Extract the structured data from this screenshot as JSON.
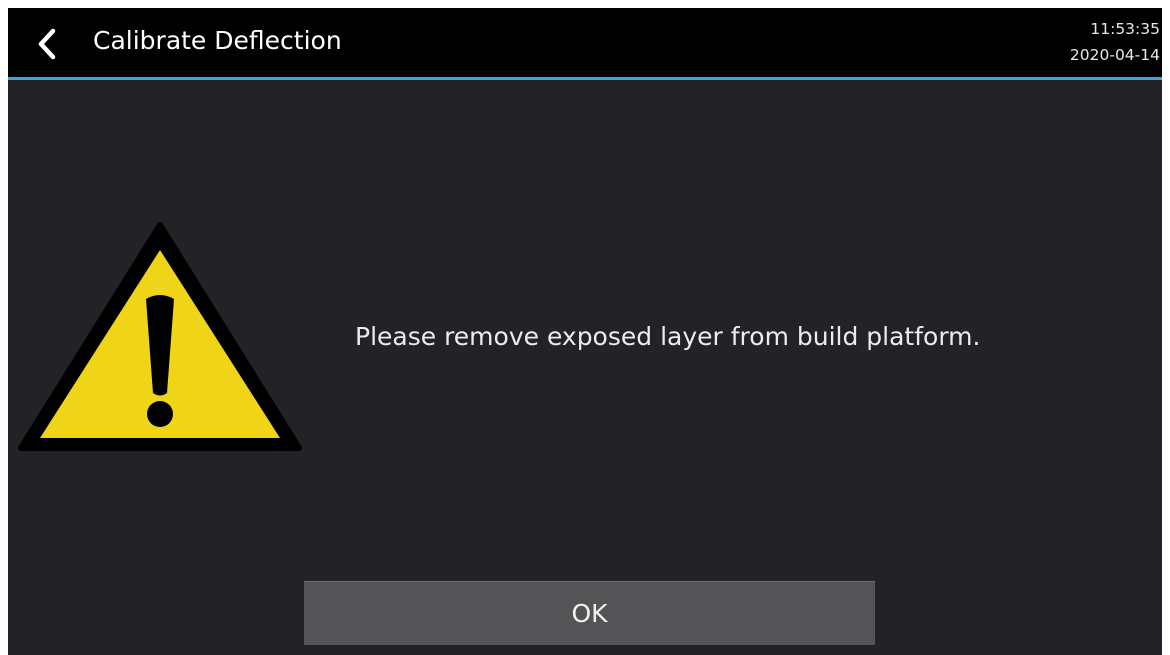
{
  "header": {
    "back_icon": "chevron-left-icon",
    "title": "Calibrate Deflection",
    "time": "11:53:35",
    "date": "2020-04-14"
  },
  "main": {
    "warning_icon": "warning-triangle-icon",
    "message": "Please remove exposed layer from build platform.",
    "ok_label": "OK"
  },
  "colors": {
    "screen_background": "#232227",
    "header_background": "#000000",
    "accent": "#3aa7dc",
    "warning_yellow": "#f0d418",
    "button_background": "#545456"
  }
}
